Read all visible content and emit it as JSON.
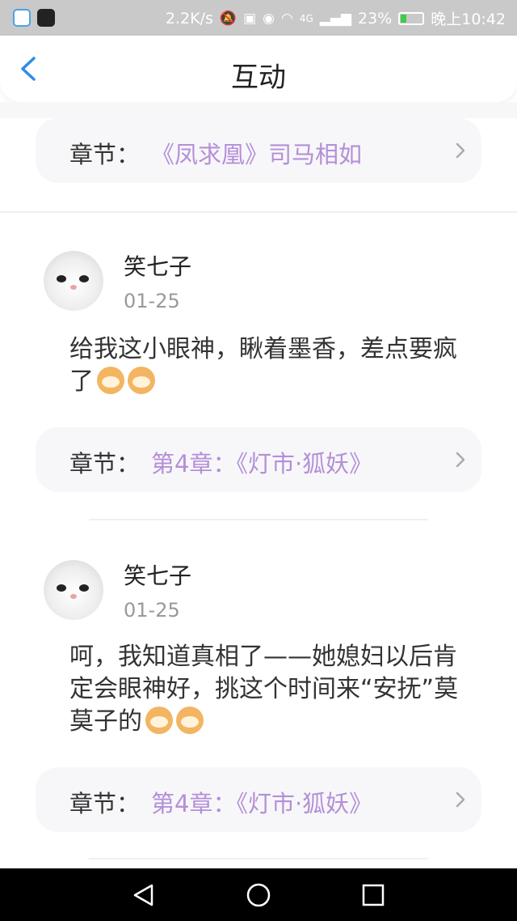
{
  "status_bar": {
    "network_speed": "2.2K/s",
    "signal": "4G",
    "battery": "23%",
    "battery_fraction": 0.23,
    "time": "晚上10:42",
    "icons": [
      "browser-app-icon",
      "tiktok-app-icon",
      "mute-icon",
      "hd-icon",
      "eye-icon",
      "wifi-icon",
      "signal-icon",
      "battery-icon"
    ]
  },
  "header": {
    "title": "互动"
  },
  "chapter_label": "章节：",
  "top_chapter": {
    "value": "《凤求凰》司马相如"
  },
  "comments": [
    {
      "name": "笑七子",
      "date": "01-25",
      "text": "给我这小眼神，瞅着墨香，差点要疯了",
      "emojis": 2,
      "chapter": "第4章：《灯市·狐妖》"
    },
    {
      "name": "笑七子",
      "date": "01-25",
      "text": "呵，我知道真相了——她媳妇以后肯定会眼神好，挑这个时间来“安抚”莫莫子的",
      "emojis": 2,
      "chapter": "第4章：《灯市·狐妖》"
    }
  ],
  "colors": {
    "accent": "#2f8ce8",
    "chapter_link": "#b48fd8",
    "status_bar": "#c9c9c9"
  }
}
